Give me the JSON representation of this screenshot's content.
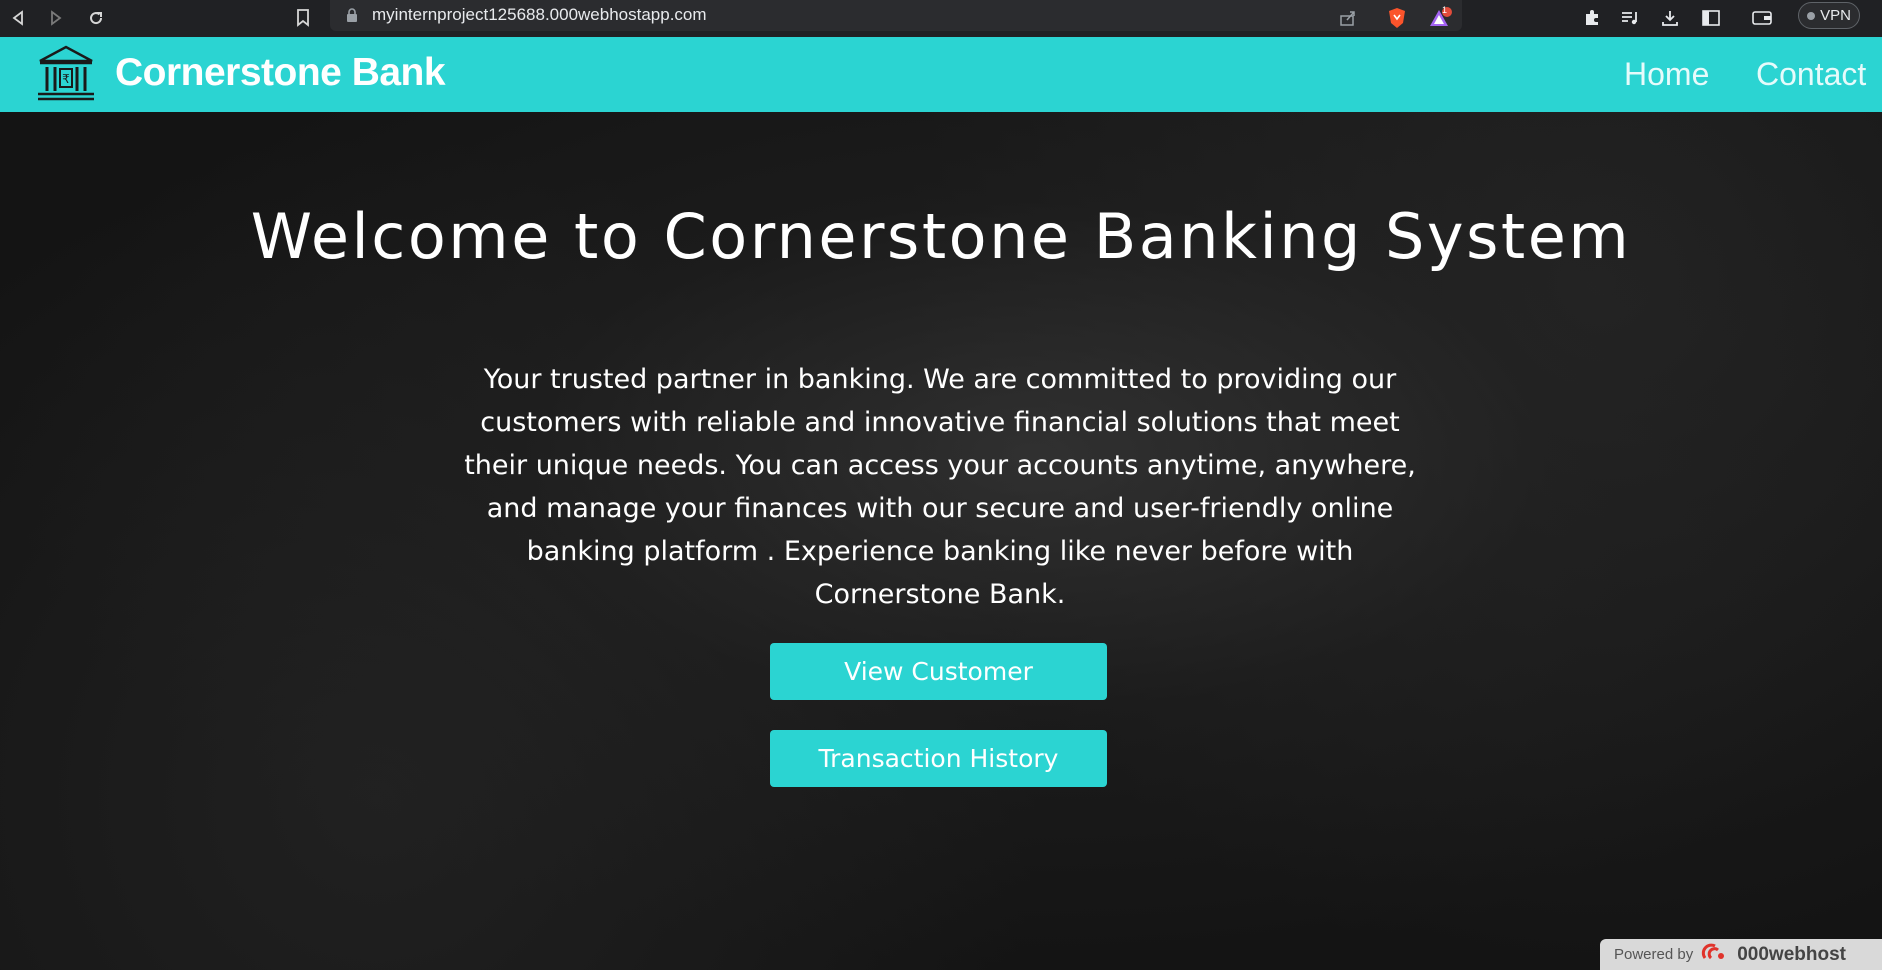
{
  "browser": {
    "url": "myinternproject125688.000webhostapp.com",
    "vpn_label": "VPN",
    "notification_count": "1"
  },
  "header": {
    "brand": "Cornerstone Bank",
    "nav": [
      {
        "label": "Home"
      },
      {
        "label": "Contact"
      }
    ]
  },
  "hero": {
    "title": "Welcome to Cornerstone Banking System",
    "description": "Your trusted partner in banking. We are committed to providing our customers with reliable and innovative financial solutions that meet their unique needs. You can access your accounts anytime, anywhere, and manage your finances with our secure and user-friendly online banking platform . Experience banking like never before with Cornerstone Bank.",
    "buttons": [
      {
        "label": "View Customer"
      },
      {
        "label": "Transaction History"
      }
    ]
  },
  "footer_badge": {
    "prefix": "Powered by",
    "brand": "000webhost"
  },
  "colors": {
    "accent": "#2bd4d2",
    "hero_bg": "#141414",
    "chrome_bg": "#202124"
  }
}
